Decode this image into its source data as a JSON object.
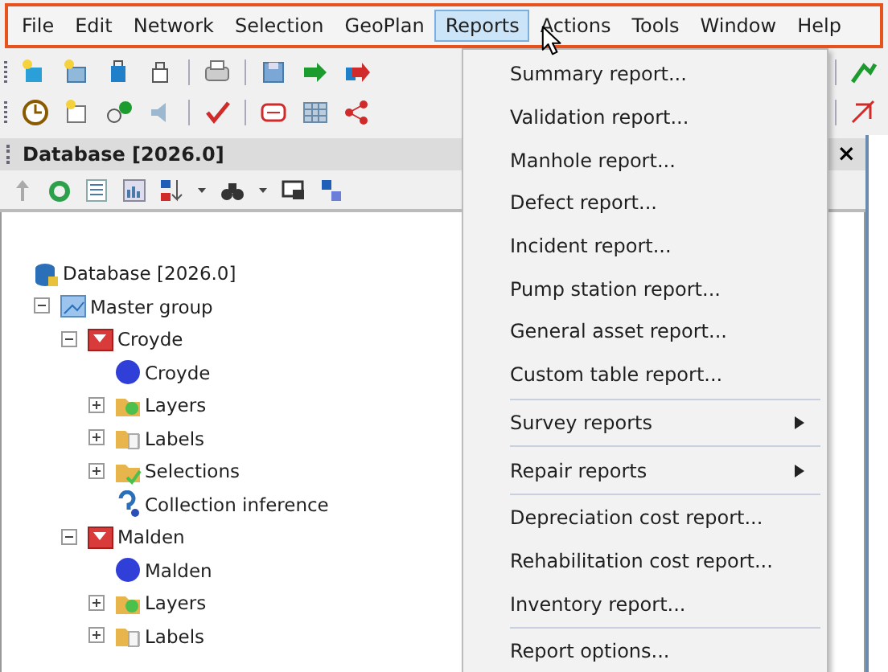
{
  "menubar": [
    {
      "label": "File",
      "selected": false
    },
    {
      "label": "Edit",
      "selected": false
    },
    {
      "label": "Network",
      "selected": false
    },
    {
      "label": "Selection",
      "selected": false
    },
    {
      "label": "GeoPlan",
      "selected": false
    },
    {
      "label": "Reports",
      "selected": true
    },
    {
      "label": "Actions",
      "selected": false
    },
    {
      "label": "Tools",
      "selected": false
    },
    {
      "label": "Window",
      "selected": false
    },
    {
      "label": "Help",
      "selected": false
    }
  ],
  "panel": {
    "title": "Database [2026.0]",
    "close": "×"
  },
  "tree": [
    {
      "label": "Database [2026.0]",
      "kind": "database",
      "children": [
        {
          "label": "Master group",
          "kind": "group",
          "expanded": true,
          "children": [
            {
              "label": "Croyde",
              "kind": "folder",
              "expanded": true,
              "children": [
                {
                  "label": "Croyde",
                  "kind": "network"
                },
                {
                  "label": "Layers",
                  "kind": "layers",
                  "expanded": false
                },
                {
                  "label": "Labels",
                  "kind": "labels",
                  "expanded": false
                },
                {
                  "label": "Selections",
                  "kind": "selections",
                  "expanded": false
                },
                {
                  "label": "Collection inference",
                  "kind": "inference"
                }
              ]
            },
            {
              "label": "Malden",
              "kind": "folder",
              "expanded": true,
              "children": [
                {
                  "label": "Malden",
                  "kind": "network"
                },
                {
                  "label": "Layers",
                  "kind": "layers",
                  "expanded": false
                },
                {
                  "label": "Labels",
                  "kind": "labels",
                  "expanded": false
                }
              ]
            }
          ]
        }
      ]
    }
  ],
  "menu": [
    {
      "kind": "item",
      "label": "Summary report..."
    },
    {
      "kind": "item",
      "label": "Validation report..."
    },
    {
      "kind": "item",
      "label": "Manhole report..."
    },
    {
      "kind": "item",
      "label": "Defect report..."
    },
    {
      "kind": "item",
      "label": "Incident report..."
    },
    {
      "kind": "item",
      "label": "Pump station report..."
    },
    {
      "kind": "item",
      "label": "General asset report..."
    },
    {
      "kind": "item",
      "label": "Custom table report..."
    },
    {
      "kind": "separator"
    },
    {
      "kind": "submenu",
      "label": "Survey reports"
    },
    {
      "kind": "separator"
    },
    {
      "kind": "submenu",
      "label": "Repair reports"
    },
    {
      "kind": "separator"
    },
    {
      "kind": "item",
      "label": "Depreciation cost report..."
    },
    {
      "kind": "item",
      "label": "Rehabilitation cost report..."
    },
    {
      "kind": "item",
      "label": "Inventory report..."
    },
    {
      "kind": "separator"
    },
    {
      "kind": "item",
      "label": "Report options..."
    }
  ]
}
